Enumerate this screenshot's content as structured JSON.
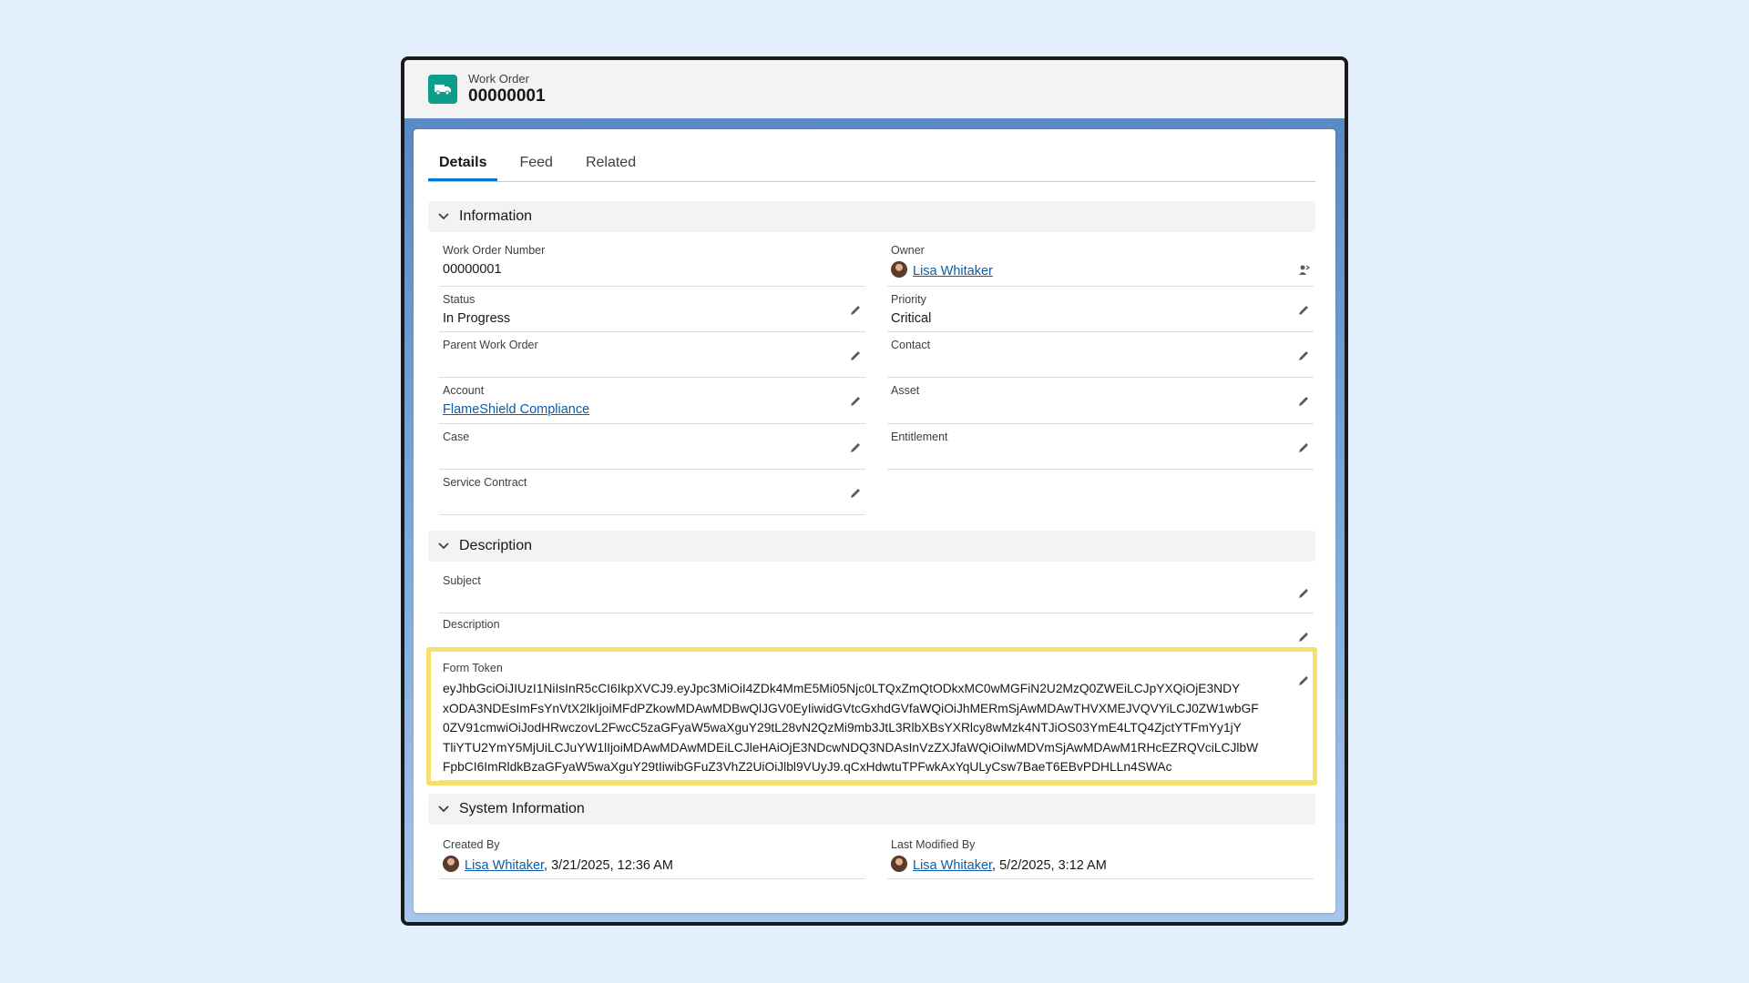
{
  "header": {
    "object_type": "Work Order",
    "record_number": "00000001",
    "icon": "van-icon",
    "icon_color": "#0d9d8b"
  },
  "tabs": [
    "Details",
    "Feed",
    "Related"
  ],
  "active_tab": "Details",
  "sections": {
    "information": "Information",
    "description": "Description",
    "system": "System Information"
  },
  "info": {
    "work_order_number": {
      "label": "Work Order Number",
      "value": "00000001"
    },
    "owner": {
      "label": "Owner",
      "value": "Lisa Whitaker"
    },
    "status": {
      "label": "Status",
      "value": "In Progress"
    },
    "priority": {
      "label": "Priority",
      "value": "Critical"
    },
    "parent_work_order": {
      "label": "Parent Work Order",
      "value": ""
    },
    "contact": {
      "label": "Contact",
      "value": ""
    },
    "account": {
      "label": "Account",
      "value": "FlameShield Compliance"
    },
    "asset": {
      "label": "Asset",
      "value": ""
    },
    "case": {
      "label": "Case",
      "value": ""
    },
    "entitlement": {
      "label": "Entitlement",
      "value": ""
    },
    "service_contract": {
      "label": "Service Contract",
      "value": ""
    }
  },
  "description": {
    "subject": {
      "label": "Subject",
      "value": ""
    },
    "description": {
      "label": "Description",
      "value": ""
    },
    "form_token": {
      "label": "Form Token",
      "lines": [
        "eyJhbGciOiJIUzI1NiIsInR5cCI6IkpXVCJ9.eyJpc3MiOiI4ZDk4MmE5Mi05Njc0LTQxZmQtODkxMC0wMGFiN2U2MzQ0ZWEiLCJpYXQiOjE3NDY",
        "xODA3NDEsImFsYnVtX2lkIjoiMFdPZkowMDAwMDBwQlJGV0EyIiwidGVtcGxhdGVfaWQiOiJhMERmSjAwMDAwTHVXMEJVQVYiLCJ0ZW1wbGF",
        "0ZV91cmwiOiJodHRwczovL2FwcC5zaGFyaW5waXguY29tL28vN2QzMi9mb3JtL3RlbXBsYXRlcy8wMzk4NTJiOS03YmE4LTQ4ZjctYTFmYy1jY",
        "TliYTU2YmY5MjUiLCJuYW1lIjoiMDAwMDAwMDEiLCJleHAiOjE3NDcwNDQ3NDAsInVzZXJfaWQiOiIwMDVmSjAwMDAwM1RHcEZRQVciLCJlbW",
        "FpbCI6ImRldkBzaGFyaW5waXguY29tIiwibGFuZ3VhZ2UiOiJlbl9VUyJ9.qCxHdwtuTPFwkAxYqULyCsw7BaeT6EBvPDHLLn4SWAc"
      ]
    }
  },
  "system": {
    "created_by": {
      "label": "Created By",
      "user": "Lisa Whitaker",
      "date": ", 3/21/2025, 12:36 AM"
    },
    "last_modified_by": {
      "label": "Last Modified By",
      "user": "Lisa Whitaker",
      "date": ", 5/2/2025, 3:12 AM"
    }
  },
  "colors": {
    "link": "#0b5cab",
    "active_tab": "#0176d3",
    "highlight": "#f7df6f"
  }
}
